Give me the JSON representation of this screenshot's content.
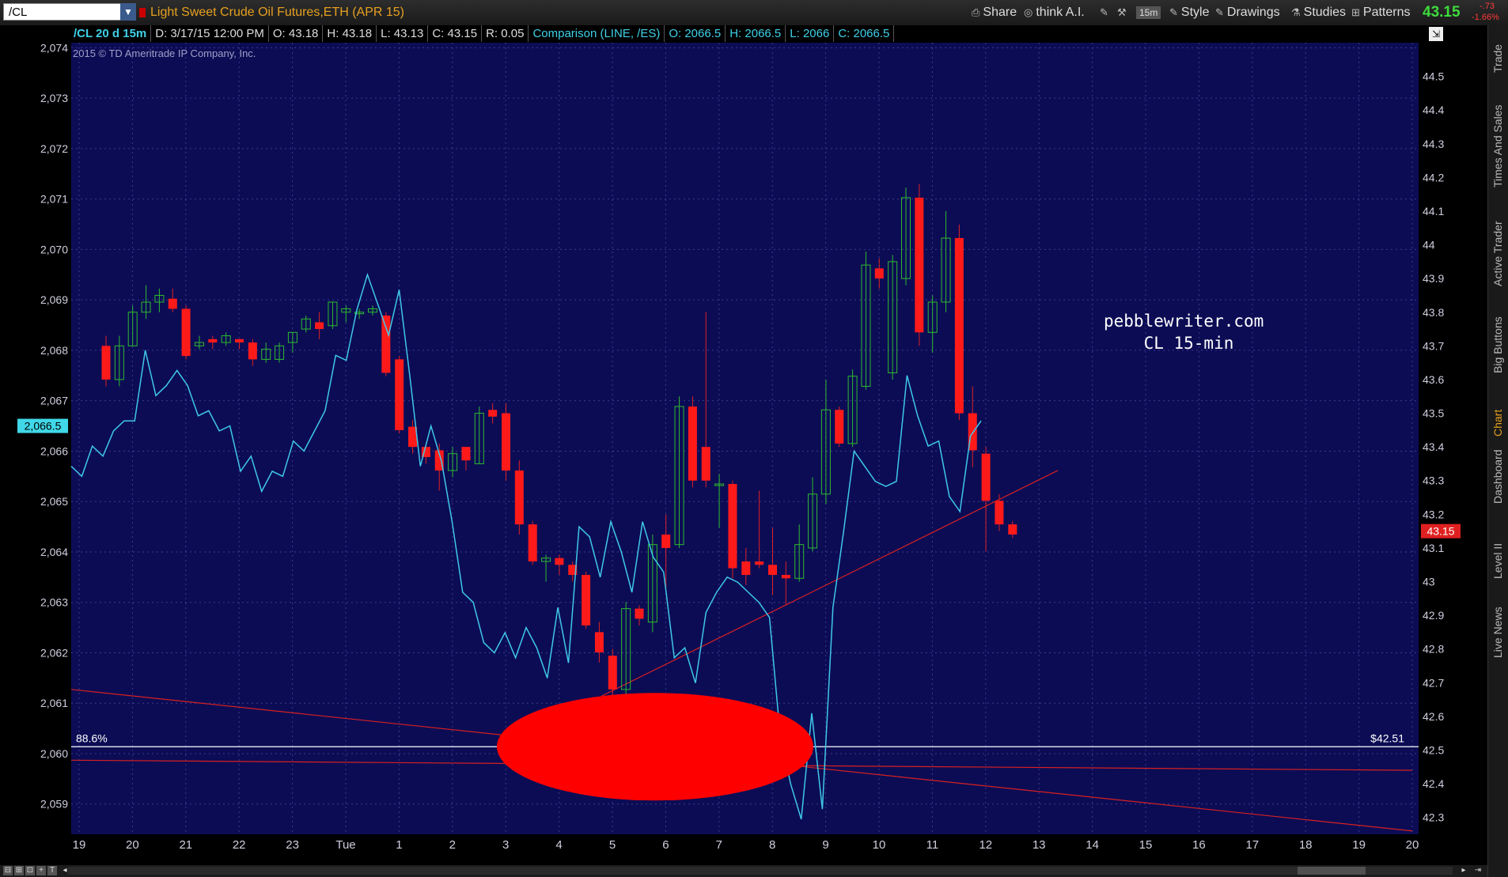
{
  "toolbar": {
    "symbol": "/CL",
    "instrument_title": "Light Sweet Crude Oil Futures,ETH (APR 15)",
    "share": "Share",
    "think": "think A.I.",
    "interval": "15m",
    "style": "Style",
    "drawings": "Drawings",
    "studies": "Studies",
    "patterns": "Patterns",
    "last_price": "43.15",
    "change": "-.73",
    "change_pct": "-1.66%"
  },
  "infobar": {
    "timeframe": "/CL 20 d 15m",
    "date": "D: 3/17/15 12:00 PM",
    "open": "O: 43.18",
    "high": "H: 43.18",
    "low": "L: 43.13",
    "close": "C: 43.15",
    "range": "R: 0.05",
    "comparison": "Comparison (LINE, /ES)",
    "cmp_open": "O: 2066.5",
    "cmp_high": "H: 2066.5",
    "cmp_low": "L: 2066",
    "cmp_close": "C: 2066.5"
  },
  "copyright": "2015 © TD Ameritrade IP Company, Inc.",
  "watermark": "pebblewriter.com\n CL 15-min",
  "side_tabs": [
    "Trade",
    "Times And Sales",
    "Active Trader",
    "Big Buttons",
    "Chart",
    "Dashboard",
    "Level II",
    "Live News"
  ],
  "chart_data": {
    "type": "candlestick",
    "left_axis": {
      "ticks": [
        "2,074",
        "2,073",
        "2,072",
        "2,071",
        "2,070",
        "2,069",
        "2,068",
        "2,067",
        "2,066",
        "2,065",
        "2,064",
        "2,063",
        "2,062",
        "2,061",
        "2,060",
        "2,059"
      ],
      "range": [
        2058.4,
        2074.1
      ],
      "current_label": "2,066.5"
    },
    "right_axis": {
      "ticks": [
        "44.5",
        "44.4",
        "44.3",
        "44.2",
        "44.1",
        "44",
        "43.9",
        "43.8",
        "43.7",
        "43.6",
        "43.5",
        "43.4",
        "43.3",
        "43.2",
        "43.1",
        "43",
        "42.9",
        "42.8",
        "42.7",
        "42.6",
        "42.5",
        "42.4",
        "42.3"
      ],
      "range": [
        42.25,
        44.6
      ],
      "current_label": "43.15"
    },
    "x_ticks": [
      "19",
      "20",
      "21",
      "22",
      "23",
      "Tue",
      "1",
      "2",
      "3",
      "4",
      "5",
      "6",
      "7",
      "8",
      "9",
      "10",
      "11",
      "12",
      "13",
      "14",
      "15",
      "16",
      "17",
      "18",
      "19",
      "20"
    ],
    "candles": [
      {
        "o": 43.7,
        "c": 43.6,
        "h": 43.73,
        "l": 43.58
      },
      {
        "o": 43.6,
        "c": 43.7,
        "h": 43.73,
        "l": 43.58
      },
      {
        "o": 43.7,
        "c": 43.8,
        "h": 43.82,
        "l": 43.7
      },
      {
        "o": 43.8,
        "c": 43.83,
        "h": 43.88,
        "l": 43.78
      },
      {
        "o": 43.83,
        "c": 43.85,
        "h": 43.87,
        "l": 43.8
      },
      {
        "o": 43.84,
        "c": 43.81,
        "h": 43.87,
        "l": 43.8
      },
      {
        "o": 43.81,
        "c": 43.67,
        "h": 43.82,
        "l": 43.66
      },
      {
        "o": 43.7,
        "c": 43.71,
        "h": 43.73,
        "l": 43.69
      },
      {
        "o": 43.72,
        "c": 43.71,
        "h": 43.73,
        "l": 43.69
      },
      {
        "o": 43.71,
        "c": 43.73,
        "h": 43.74,
        "l": 43.7
      },
      {
        "o": 43.72,
        "c": 43.71,
        "h": 43.72,
        "l": 43.69
      },
      {
        "o": 43.71,
        "c": 43.66,
        "h": 43.72,
        "l": 43.64
      },
      {
        "o": 43.66,
        "c": 43.69,
        "h": 43.71,
        "l": 43.65
      },
      {
        "o": 43.66,
        "c": 43.7,
        "h": 43.71,
        "l": 43.65
      },
      {
        "o": 43.71,
        "c": 43.74,
        "h": 43.74,
        "l": 43.68
      },
      {
        "o": 43.75,
        "c": 43.78,
        "h": 43.79,
        "l": 43.74
      },
      {
        "o": 43.77,
        "c": 43.75,
        "h": 43.8,
        "l": 43.72
      },
      {
        "o": 43.76,
        "c": 43.83,
        "h": 43.83,
        "l": 43.75
      },
      {
        "o": 43.8,
        "c": 43.81,
        "h": 43.82,
        "l": 43.77
      },
      {
        "o": 43.8,
        "c": 43.8,
        "h": 43.81,
        "l": 43.78
      },
      {
        "o": 43.8,
        "c": 43.81,
        "h": 43.82,
        "l": 43.79
      },
      {
        "o": 43.79,
        "c": 43.62,
        "h": 43.8,
        "l": 43.61
      },
      {
        "o": 43.66,
        "c": 43.45,
        "h": 43.67,
        "l": 43.44
      },
      {
        "o": 43.46,
        "c": 43.4,
        "h": 43.48,
        "l": 43.38
      },
      {
        "o": 43.4,
        "c": 43.37,
        "h": 43.41,
        "l": 43.35
      },
      {
        "o": 43.39,
        "c": 43.33,
        "h": 43.41,
        "l": 43.27
      },
      {
        "o": 43.33,
        "c": 43.38,
        "h": 43.4,
        "l": 43.31
      },
      {
        "o": 43.4,
        "c": 43.36,
        "h": 43.4,
        "l": 43.33
      },
      {
        "o": 43.35,
        "c": 43.5,
        "h": 43.52,
        "l": 43.35
      },
      {
        "o": 43.51,
        "c": 43.49,
        "h": 43.53,
        "l": 43.47
      },
      {
        "o": 43.5,
        "c": 43.33,
        "h": 43.53,
        "l": 43.3
      },
      {
        "o": 43.33,
        "c": 43.17,
        "h": 43.36,
        "l": 43.14
      },
      {
        "o": 43.17,
        "c": 43.06,
        "h": 43.18,
        "l": 43.05
      },
      {
        "o": 43.06,
        "c": 43.07,
        "h": 43.08,
        "l": 43.0
      },
      {
        "o": 43.07,
        "c": 43.05,
        "h": 43.08,
        "l": 43.02
      },
      {
        "o": 43.05,
        "c": 43.02,
        "h": 43.06,
        "l": 43.0
      },
      {
        "o": 43.02,
        "c": 42.87,
        "h": 43.03,
        "l": 42.86
      },
      {
        "o": 42.85,
        "c": 42.79,
        "h": 42.88,
        "l": 42.76
      },
      {
        "o": 42.78,
        "c": 42.68,
        "h": 42.8,
        "l": 42.63
      },
      {
        "o": 42.68,
        "c": 42.92,
        "h": 42.94,
        "l": 42.66
      },
      {
        "o": 42.92,
        "c": 42.89,
        "h": 42.93,
        "l": 42.87
      },
      {
        "o": 42.88,
        "c": 43.11,
        "h": 43.14,
        "l": 42.85
      },
      {
        "o": 43.14,
        "c": 43.1,
        "h": 43.2,
        "l": 42.98
      },
      {
        "o": 43.11,
        "c": 43.52,
        "h": 43.55,
        "l": 43.1
      },
      {
        "o": 43.52,
        "c": 43.3,
        "h": 43.55,
        "l": 43.28
      },
      {
        "o": 43.4,
        "c": 43.3,
        "h": 43.8,
        "l": 43.28
      },
      {
        "o": 43.29,
        "c": 43.29,
        "h": 43.32,
        "l": 43.16
      },
      {
        "o": 43.29,
        "c": 43.04,
        "h": 43.3,
        "l": 43.01
      },
      {
        "o": 43.06,
        "c": 43.02,
        "h": 43.1,
        "l": 42.99
      },
      {
        "o": 43.06,
        "c": 43.05,
        "h": 43.27,
        "l": 43.04
      },
      {
        "o": 43.05,
        "c": 43.02,
        "h": 43.16,
        "l": 42.96
      },
      {
        "o": 43.02,
        "c": 43.01,
        "h": 43.06,
        "l": 42.93
      },
      {
        "o": 43.01,
        "c": 43.11,
        "h": 43.17,
        "l": 43.0
      },
      {
        "o": 43.1,
        "c": 43.26,
        "h": 43.31,
        "l": 43.09
      },
      {
        "o": 43.26,
        "c": 43.51,
        "h": 43.6,
        "l": 43.23
      },
      {
        "o": 43.51,
        "c": 43.41,
        "h": 43.52,
        "l": 43.4
      },
      {
        "o": 43.41,
        "c": 43.61,
        "h": 43.63,
        "l": 43.4
      },
      {
        "o": 43.58,
        "c": 43.94,
        "h": 43.98,
        "l": 43.57
      },
      {
        "o": 43.93,
        "c": 43.9,
        "h": 43.96,
        "l": 43.87
      },
      {
        "o": 43.62,
        "c": 43.95,
        "h": 43.97,
        "l": 43.6
      },
      {
        "o": 43.9,
        "c": 44.14,
        "h": 44.17,
        "l": 43.88
      },
      {
        "o": 44.14,
        "c": 43.74,
        "h": 44.18,
        "l": 43.7
      },
      {
        "o": 43.74,
        "c": 43.83,
        "h": 43.85,
        "l": 43.68
      },
      {
        "o": 43.83,
        "c": 44.02,
        "h": 44.1,
        "l": 43.8
      },
      {
        "o": 44.02,
        "c": 43.5,
        "h": 44.06,
        "l": 43.48
      },
      {
        "o": 43.5,
        "c": 43.39,
        "h": 43.58,
        "l": 43.34
      },
      {
        "o": 43.38,
        "c": 43.24,
        "h": 43.4,
        "l": 43.09
      },
      {
        "o": 43.24,
        "c": 43.17,
        "h": 43.26,
        "l": 43.15
      },
      {
        "o": 43.17,
        "c": 43.14,
        "h": 43.18,
        "l": 43.13
      }
    ],
    "comparison": {
      "name": "/ES",
      "values": [
        2065.7,
        2065.5,
        2066.1,
        2065.9,
        2066.4,
        2066.6,
        2066.6,
        2068.0,
        2067.1,
        2067.3,
        2067.6,
        2067.3,
        2066.7,
        2066.8,
        2066.4,
        2066.5,
        2065.6,
        2065.9,
        2065.2,
        2065.6,
        2065.5,
        2066.2,
        2066.0,
        2066.4,
        2066.8,
        2067.9,
        2067.8,
        2068.8,
        2069.5,
        2068.9,
        2068.3,
        2069.2,
        2067.5,
        2065.7,
        2066.5,
        2065.8,
        2064.6,
        2063.2,
        2063.0,
        2062.2,
        2062.0,
        2062.4,
        2061.9,
        2062.5,
        2062.1,
        2061.5,
        2062.9,
        2061.8,
        2064.5,
        2064.3,
        2063.5,
        2064.6,
        2064.0,
        2063.2,
        2064.6,
        2063.9,
        2063.6,
        2061.9,
        2062.1,
        2061.4,
        2062.8,
        2063.2,
        2063.5,
        2063.4,
        2063.2,
        2063.0,
        2062.7,
        2060.4,
        2059.4,
        2058.7,
        2060.8,
        2058.9,
        2062.9,
        2064.4,
        2066.0,
        2065.7,
        2065.4,
        2065.3,
        2065.4,
        2067.5,
        2066.7,
        2066.1,
        2066.2,
        2065.1,
        2064.8,
        2066.3,
        2066.6
      ]
    },
    "annotations": {
      "fib_label": "88.6%",
      "fib_price": "$42.51",
      "fib_value": 42.51
    }
  }
}
